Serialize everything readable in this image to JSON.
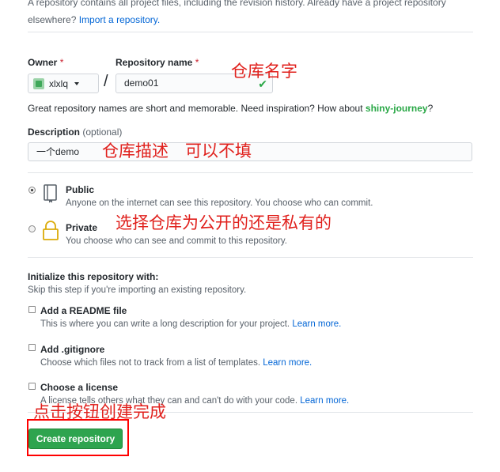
{
  "intro": {
    "line1": "A repository contains all project files, including the revision history. Already have a project repository",
    "line2_prefix": "elsewhere?",
    "import_link": "Import a repository."
  },
  "owner": {
    "label": "Owner",
    "required_mark": "*",
    "value": "xlxlq"
  },
  "repo": {
    "label": "Repository name",
    "required_mark": "*",
    "value": "demo01",
    "separator": "/"
  },
  "name_hint": {
    "text": "Great repository names are short and memorable. Need inspiration? How about",
    "suggestion": "shiny-journey",
    "end": "?"
  },
  "description": {
    "label": "Description",
    "optional": "(optional)",
    "value": "一个demo"
  },
  "visibility": {
    "public": {
      "title": "Public",
      "note": "Anyone on the internet can see this repository. You choose who can commit.",
      "selected": true
    },
    "private": {
      "title": "Private",
      "note": "You choose who can see and commit to this repository.",
      "selected": false
    }
  },
  "init": {
    "title": "Initialize this repository with:",
    "subtitle": "Skip this step if you're importing an existing repository.",
    "options": [
      {
        "title": "Add a README file",
        "note": "This is where you can write a long description for your project.",
        "link": "Learn more."
      },
      {
        "title": "Add .gitignore",
        "note": "Choose which files not to track from a list of templates.",
        "link": "Learn more."
      },
      {
        "title": "Choose a license",
        "note": "A license tells others what they can and can't do with your code.",
        "link": "Learn more."
      }
    ]
  },
  "create_button": "Create repository",
  "annotations": {
    "repo_name": "仓库名字",
    "description": "仓库描述　可以不填",
    "visibility": "选择仓库为公开的还是私有的",
    "create": "点击按钮创建完成"
  },
  "colors": {
    "accent_green": "#2ea44f",
    "link_blue": "#0366d6",
    "annotation_red": "#e0201c"
  }
}
